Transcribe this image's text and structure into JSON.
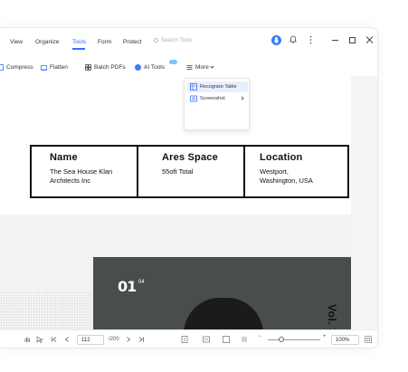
{
  "menu": {
    "items": [
      {
        "label": "View",
        "active": false
      },
      {
        "label": "Organize",
        "active": false
      },
      {
        "label": "Tools",
        "active": true
      },
      {
        "label": "Form",
        "active": false
      },
      {
        "label": "Protect",
        "active": false
      }
    ],
    "search_placeholder": "Search Tools"
  },
  "toolbar": {
    "compress": "Compress",
    "flatten": "Flatten",
    "batch_pdfs": "Batch PDFs",
    "ai_tools": "AI Tools",
    "more": "More"
  },
  "dropdown": {
    "items": [
      {
        "label": "Recognize Table",
        "icon": "table-scan-icon",
        "highlighted": true
      },
      {
        "label": "Screenshot",
        "icon": "screenshot-icon",
        "submenu": true
      }
    ]
  },
  "document": {
    "table": {
      "headers": [
        "Name",
        "Ares Space",
        "Location"
      ],
      "values": [
        [
          "The Sea House Klan",
          "Architects Inc"
        ],
        [
          "55oft Total"
        ],
        [
          "Westport,",
          "Washington, USA"
        ]
      ]
    },
    "photo": {
      "number": "01",
      "separator": "/",
      "total": "04",
      "vertical_text": "Vol. 3 N"
    }
  },
  "statusbar": {
    "current_page": "112",
    "total_pages": "/200",
    "zoom": "100%"
  },
  "colors": {
    "accent": "#3b6ef6",
    "photo_bg": "#4a4d4e"
  }
}
